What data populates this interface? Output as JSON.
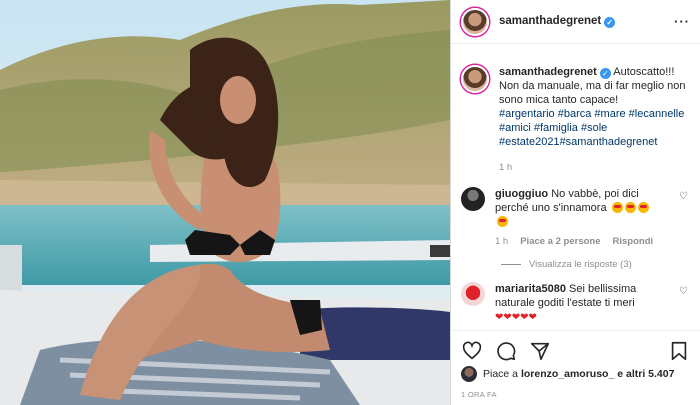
{
  "post": {
    "username": "samanthadegrenet",
    "caption_lines": [
      "Autoscatto!!!",
      "Non da manuale, ma di far meglio non",
      "sono mica tanto capace!"
    ],
    "tags": [
      "#argentario",
      "#barca",
      "#mare",
      "#lecannelle",
      "#amici",
      "#famiglia",
      "#sole",
      "#estate2021",
      "#samanthadegrenet"
    ],
    "caption_time": "1 h"
  },
  "comments": [
    {
      "username": "giuoggiuo",
      "text": "No vabbè, poi dici perché uno s'innamora",
      "time": "1 h",
      "likes": "Piace a 2 persone",
      "reply": "Rispondi",
      "view_replies": "Visualizza le risposte (3)"
    },
    {
      "username": "mariarita5080",
      "text": "Sei bellissima naturale goditi l'estate ti meri"
    }
  ],
  "footer": {
    "likes_prefix": "Piace a ",
    "likes_user": "lorenzo_amoruso_",
    "likes_suffix": " e altri 5.407",
    "time_ago": "1 ORA FA"
  },
  "colors": {
    "link": "#00376b",
    "verified": "#3897f0",
    "muted": "#8e8e8e"
  }
}
